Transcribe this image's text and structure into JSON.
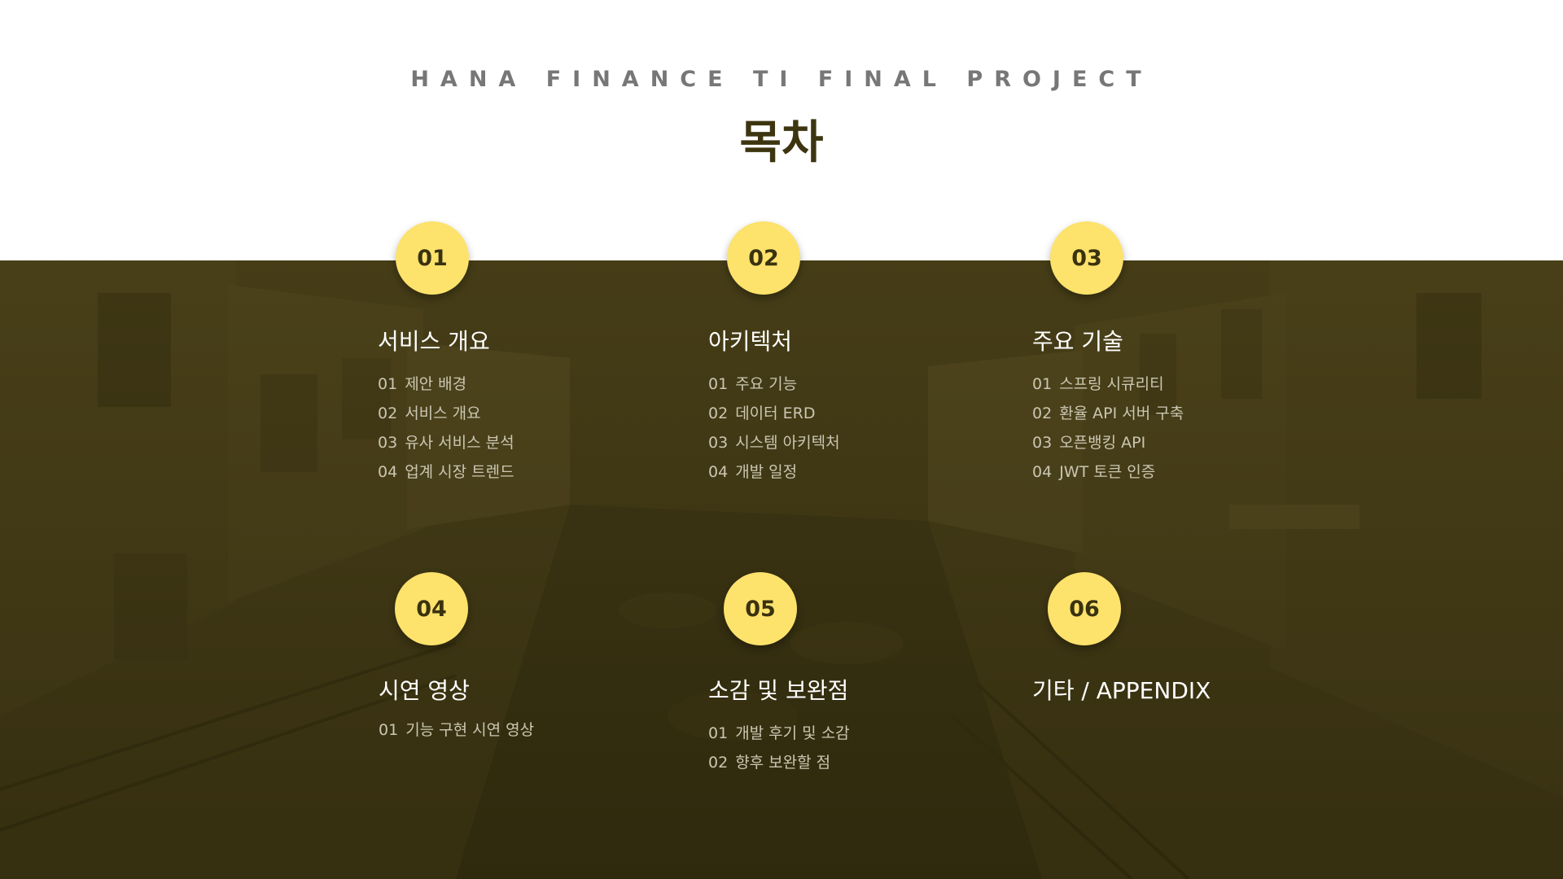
{
  "header": {
    "subtitle": "HANA FINANCE TI FINAL PROJECT",
    "title": "목차"
  },
  "colors": {
    "accent_yellow": "#fde26c",
    "band_olive": "#3f3714",
    "title_dark": "#3d3510",
    "subtitle_gray": "#777777"
  },
  "sections": [
    {
      "number": "01",
      "title": "서비스 개요",
      "items": [
        {
          "num": "01",
          "text": "제안 배경"
        },
        {
          "num": "02",
          "text": "서비스 개요"
        },
        {
          "num": "03",
          "text": "유사 서비스 분석"
        },
        {
          "num": "04",
          "text": "업계 시장 트렌드"
        }
      ]
    },
    {
      "number": "02",
      "title": "아키텍처",
      "items": [
        {
          "num": "01",
          "text": "주요 기능"
        },
        {
          "num": "02",
          "text": "데이터 ERD"
        },
        {
          "num": "03",
          "text": "시스템 아키텍처"
        },
        {
          "num": "04",
          "text": "개발 일정"
        }
      ]
    },
    {
      "number": "03",
      "title": "주요 기술",
      "items": [
        {
          "num": "01",
          "text": "스프링 시큐리티"
        },
        {
          "num": "02",
          "text": "환율 API 서버 구축"
        },
        {
          "num": "03",
          "text": "오픈뱅킹 API"
        },
        {
          "num": "04",
          "text": "JWT 토큰 인증"
        }
      ]
    },
    {
      "number": "04",
      "title": "시연 영상",
      "items": [
        {
          "num": "01",
          "text": "기능 구현 시연 영상"
        }
      ]
    },
    {
      "number": "05",
      "title": "소감 및 보완점",
      "items": [
        {
          "num": "01",
          "text": "개발 후기 및 소감"
        },
        {
          "num": "02",
          "text": "향후 보완할 점"
        }
      ]
    },
    {
      "number": "06",
      "title": "기타 / APPENDIX",
      "items": []
    }
  ]
}
